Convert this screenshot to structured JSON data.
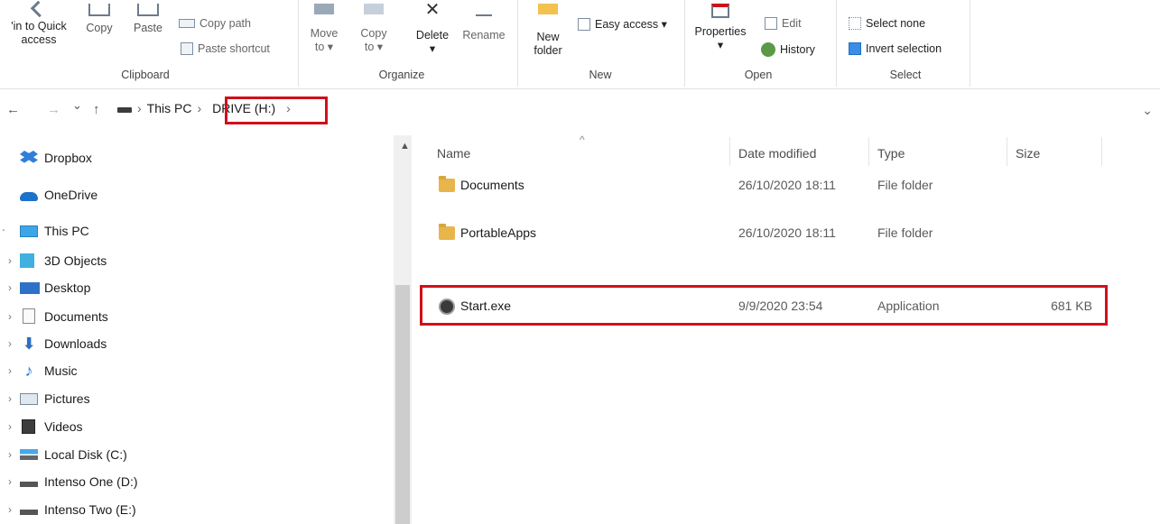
{
  "ribbon": {
    "clipboard": {
      "pin_label_1": "'in to Quick",
      "pin_label_2": "access",
      "copy_label": "Copy",
      "paste_label": "Paste",
      "copy_path_label": "Copy path",
      "paste_shortcut_label": "Paste shortcut",
      "group_label": "Clipboard"
    },
    "organize": {
      "move_to_1": "Move",
      "move_to_2": "to ▾",
      "copy_to_1": "Copy",
      "copy_to_2": "to ▾",
      "delete_label": "Delete",
      "delete_arrow": "▾",
      "rename_label": "Rename",
      "group_label": "Organize"
    },
    "new": {
      "new_folder_1": "New",
      "new_folder_2": "folder",
      "easy_access_label": "Easy access ▾",
      "group_label": "New"
    },
    "open": {
      "properties_label": "Properties",
      "properties_arrow": "▾",
      "edit_label": "Edit",
      "history_label": "History",
      "group_label": "Open"
    },
    "select": {
      "select_none_label": "Select none",
      "invert_selection_label": "Invert selection",
      "group_label": "Select"
    }
  },
  "address_bar": {
    "back": "←",
    "forward": "→",
    "recent": "⌄",
    "up": "↑",
    "sep1": "›",
    "crumb_this_pc": "This PC",
    "sep2": "›",
    "crumb_drive": "DRIVE (H:)",
    "sep3": "›",
    "dropdown": "⌄"
  },
  "nav_pane": {
    "items": [
      {
        "label": "Dropbox",
        "icon": "dropbox-icon"
      },
      {
        "label": "OneDrive",
        "icon": "onedrive-icon"
      },
      {
        "label": "This PC",
        "icon": "monitor-icon"
      },
      {
        "label": "3D Objects",
        "icon": "cube-icon"
      },
      {
        "label": "Desktop",
        "icon": "desktop-icon"
      },
      {
        "label": "Documents",
        "icon": "document-icon"
      },
      {
        "label": "Downloads",
        "icon": "download-arrow-icon"
      },
      {
        "label": "Music",
        "icon": "music-note-icon"
      },
      {
        "label": "Pictures",
        "icon": "pictures-icon"
      },
      {
        "label": "Videos",
        "icon": "videos-icon"
      },
      {
        "label": "Local Disk (C:)",
        "icon": "windows-drive-icon"
      },
      {
        "label": "Intenso One (D:)",
        "icon": "drive-icon"
      },
      {
        "label": "Intenso Two (E:)",
        "icon": "drive-icon"
      }
    ]
  },
  "file_list": {
    "columns": {
      "name": "Name",
      "date_modified": "Date modified",
      "type": "Type",
      "size": "Size"
    },
    "sort_indicator": "^",
    "rows": [
      {
        "name": "Documents",
        "date_modified": "26/10/2020 18:11",
        "type": "File folder",
        "size": ""
      },
      {
        "name": "PortableApps",
        "date_modified": "26/10/2020 18:11",
        "type": "File folder",
        "size": ""
      },
      {
        "name": "Start.exe",
        "date_modified": "9/9/2020 23:54",
        "type": "Application",
        "size": "681 KB"
      }
    ]
  },
  "colors": {
    "highlight_box": "#d0101b",
    "folder": "#e8b54a",
    "accent_blue": "#0078d7"
  }
}
